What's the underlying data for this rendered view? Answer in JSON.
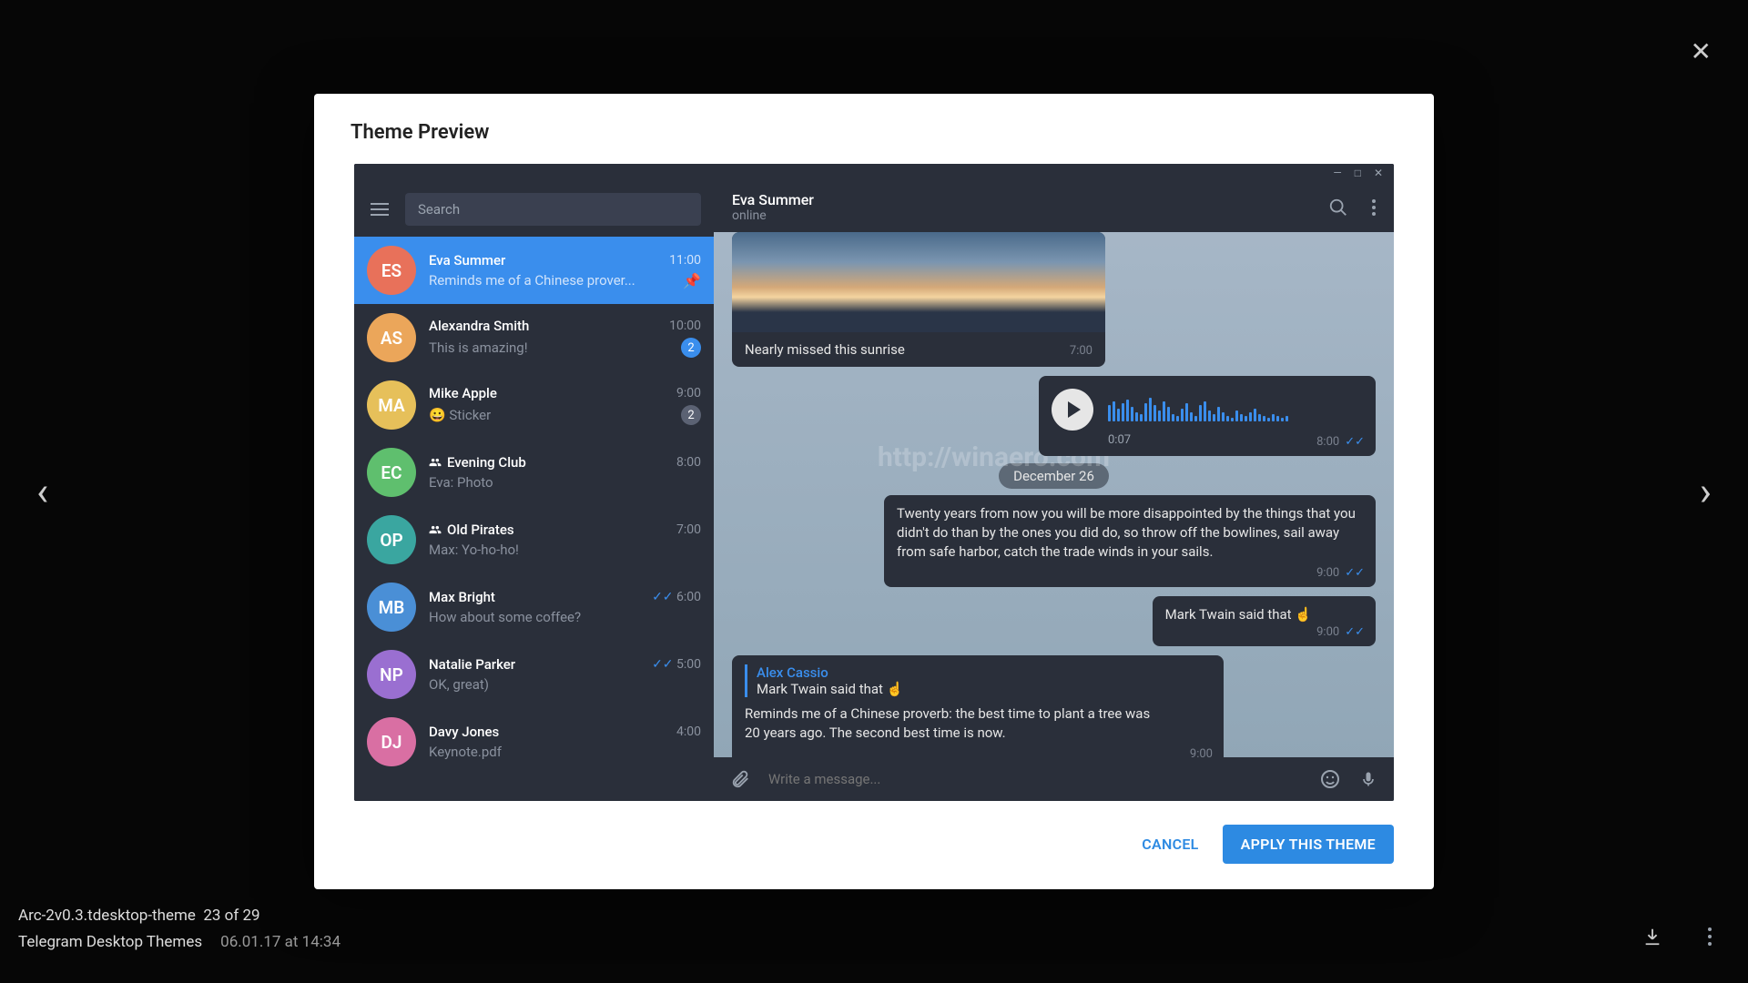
{
  "lightbox": {
    "filename": "Arc-2v0.3.tdesktop-theme",
    "counter": "23 of 29",
    "album": "Telegram Desktop Themes",
    "date": "06.01.17 at 14:34"
  },
  "modal": {
    "title": "Theme Preview",
    "cancel": "CANCEL",
    "apply": "APPLY THIS THEME"
  },
  "search_placeholder": "Search",
  "header": {
    "name": "Eva Summer",
    "status": "online"
  },
  "chats": [
    {
      "initials": "ES",
      "name": "Eva Summer",
      "time": "11:00",
      "preview": "Reminds me of a Chinese prover...",
      "avatar": "#e8715a",
      "active": true,
      "pinned": true
    },
    {
      "initials": "AS",
      "name": "Alexandra Smith",
      "time": "10:00",
      "preview": "This is amazing!",
      "avatar": "#eba65a",
      "badge": "2",
      "badgeBlue": true
    },
    {
      "initials": "MA",
      "name": "Mike Apple",
      "time": "9:00",
      "preview": "😀 Sticker",
      "avatar": "#e6c05a",
      "badge": "2"
    },
    {
      "initials": "EC",
      "name": "Evening Club",
      "time": "8:00",
      "preview": "Eva: Photo",
      "avatar": "#5fbf6e",
      "group": true
    },
    {
      "initials": "OP",
      "name": "Old Pirates",
      "time": "7:00",
      "preview": "Max: Yo-ho-ho!",
      "avatar": "#3aa6a0",
      "group": true
    },
    {
      "initials": "MB",
      "name": "Max Bright",
      "time": "6:00",
      "preview": "How about some coffee?",
      "avatar": "#4a8fd6",
      "checks": true
    },
    {
      "initials": "NP",
      "name": "Natalie Parker",
      "time": "5:00",
      "preview": "OK, great)",
      "avatar": "#9a6fd1",
      "checks": true
    },
    {
      "initials": "DJ",
      "name": "Davy Jones",
      "time": "4:00",
      "preview": "Keynote.pdf",
      "avatar": "#d96fa3"
    }
  ],
  "messages": {
    "image_caption": "Nearly missed this sunrise",
    "image_time": "7:00",
    "voice_duration": "0:07",
    "voice_time": "8:00",
    "date_separator": "December 26",
    "quote_out_text": "Twenty years from now you will be more disappointed by the things that you didn't do than by the ones you did do, so throw off the bowlines, sail away from safe harbor, catch the trade winds in your sails.",
    "quote_out_time": "9:00",
    "twain_text": "Mark Twain said that ☝️",
    "twain_time": "9:00",
    "reply_name": "Alex Cassio",
    "reply_quote": "Mark Twain said that ☝️",
    "reply_body": "Reminds me of a Chinese proverb: the best time to plant a tree was 20 years ago. The second best time is now.",
    "reply_time": "9:00"
  },
  "compose_placeholder": "Write a message..."
}
